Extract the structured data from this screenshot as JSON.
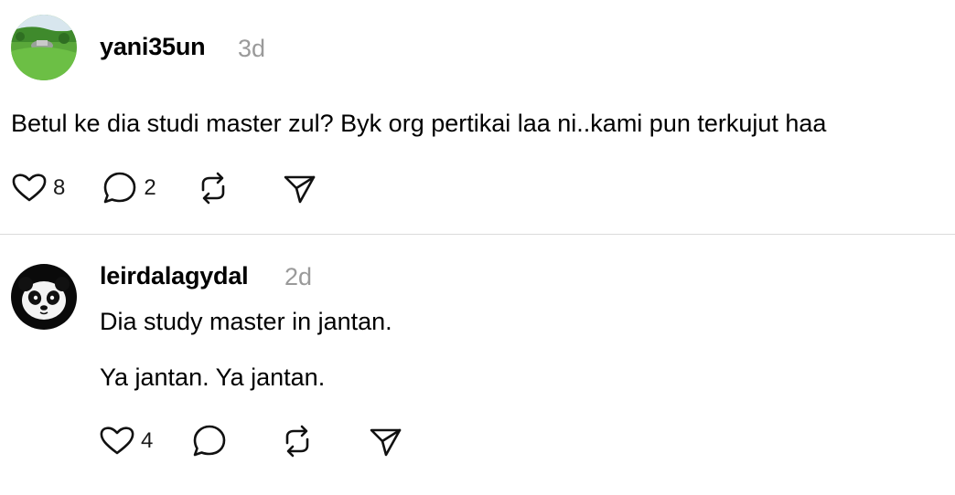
{
  "posts": [
    {
      "username": "yani35un",
      "timestamp": "3d",
      "text": "Betul ke dia studi master zul? Byk org pertikai laa ni..kami pun terkujut haa",
      "likes": "8",
      "replies": "2",
      "avatar_icon": "landscape-photo-avatar"
    },
    {
      "username": "leirdalagydal",
      "timestamp": "2d",
      "lines": [
        "Dia study master in jantan.",
        "Ya jantan. Ya jantan."
      ],
      "likes": "4",
      "avatar_icon": "panda-avatar"
    }
  ],
  "icons": {
    "like": "heart-icon",
    "reply": "comment-bubble-icon",
    "repost": "repost-icon",
    "share": "send-icon"
  },
  "colors": {
    "text": "#000000",
    "muted": "#9a9a9a",
    "divider": "#dbdbdb"
  }
}
